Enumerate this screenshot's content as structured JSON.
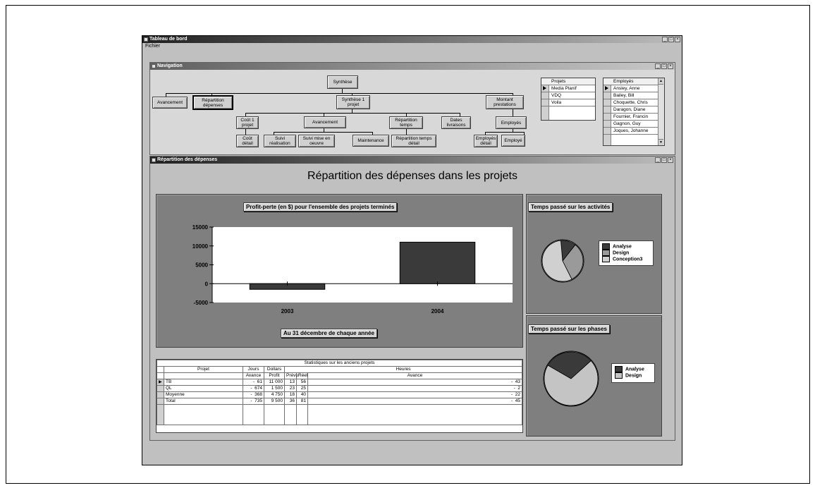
{
  "app": {
    "title": "Tableau de bord",
    "menu": [
      "Fichier"
    ]
  },
  "nav": {
    "title": "Navigation",
    "buttons": {
      "synthese": "Synthèse",
      "avancement": "Avancement",
      "repartition_depenses": "Répartition dépenses",
      "synthese1": "Synthèse 1 projet",
      "montant_prestations": "Montant prestations",
      "cout1": "Coût 1 projet",
      "avancement2": "Avancement",
      "repartition_temps": "Répartition temps",
      "dates_livraisons": "Dates livraisons",
      "employes": "Employés",
      "cout_detail": "Coût détail",
      "suivi_realisation": "Suivi réalisation",
      "suivi_mise": "Suivi mise en oeuvre",
      "maintenance": "Maintenance",
      "repartition_temps_detail": "Répartition temps détail",
      "employes_detail": "Employés détail",
      "employe": "Employé"
    },
    "projets": {
      "header": "Projets",
      "items": [
        "Media Planif",
        "VDQ",
        "Voila"
      ]
    },
    "employes": {
      "header": "Employés",
      "items": [
        "Ansley, Anne",
        "Bailey, Bill",
        "Choquette, Chris",
        "Daragon, Diane",
        "Fournier, Francin",
        "Gagnon, Guy",
        "Joques, Johanne"
      ]
    }
  },
  "repartition": {
    "title": "Répartition des dépenses",
    "heading": "Répartition des dépenses dans les projets",
    "bar_title": "Profit-perte (en $) pour l'ensemble des projets terminés",
    "bar_footer": "Au 31 décembre de chaque année",
    "pie1_title": "Temps passé sur les activités",
    "pie2_title": "Temps passé sur les phases"
  },
  "stats": {
    "caption": "Statistiques sur les anciens projets",
    "headers": {
      "projet": "Projet",
      "jours": "Jours",
      "dollars": "Dollars",
      "heures": "Heures",
      "avance": "Avance",
      "profit": "Profit",
      "prevu": "Prévu",
      "reel": "Réel",
      "avance2": "Avance"
    },
    "rows": [
      {
        "projet": "TB",
        "avance": "61",
        "profit": "11 000",
        "prevu": "13",
        "reel": "56",
        "avance2": "43"
      },
      {
        "projet": "QL",
        "avance": "674",
        "profit": "1 500",
        "prevu": "23",
        "reel": "25",
        "avance2": "2"
      },
      {
        "projet": "Moyenne",
        "avance": "368",
        "profit": "4 750",
        "prevu": "18",
        "reel": "40",
        "avance2": "22"
      },
      {
        "projet": "Total",
        "avance": "735",
        "profit": "9 500",
        "prevu": "36",
        "reel": "81",
        "avance2": "45"
      }
    ]
  },
  "chart_data": [
    {
      "type": "bar",
      "title": "Profit-perte (en $) pour l'ensemble des projets terminés",
      "xlabel": "Au 31 décembre de chaque année",
      "categories": [
        "2003",
        "2004"
      ],
      "values": [
        -1500,
        11000
      ],
      "yticks": [
        "15000",
        "10000",
        "5000",
        "0",
        "-5000"
      ],
      "ylim": [
        -5000,
        15000
      ],
      "color": "#3a3a3a"
    },
    {
      "type": "pie",
      "title": "Temps passé sur les activités",
      "labels": [
        "Analyse",
        "Design",
        "Conception3"
      ],
      "values": [
        12,
        32,
        56
      ],
      "colors": [
        "#3a3a3a",
        "#9a9a9a",
        "#d0d0d0"
      ]
    },
    {
      "type": "pie",
      "title": "Temps passé sur les phases",
      "labels": [
        "Analyse",
        "Design"
      ],
      "values": [
        30,
        70
      ],
      "colors": [
        "#3a3a3a",
        "#c4c4c4"
      ]
    }
  ]
}
